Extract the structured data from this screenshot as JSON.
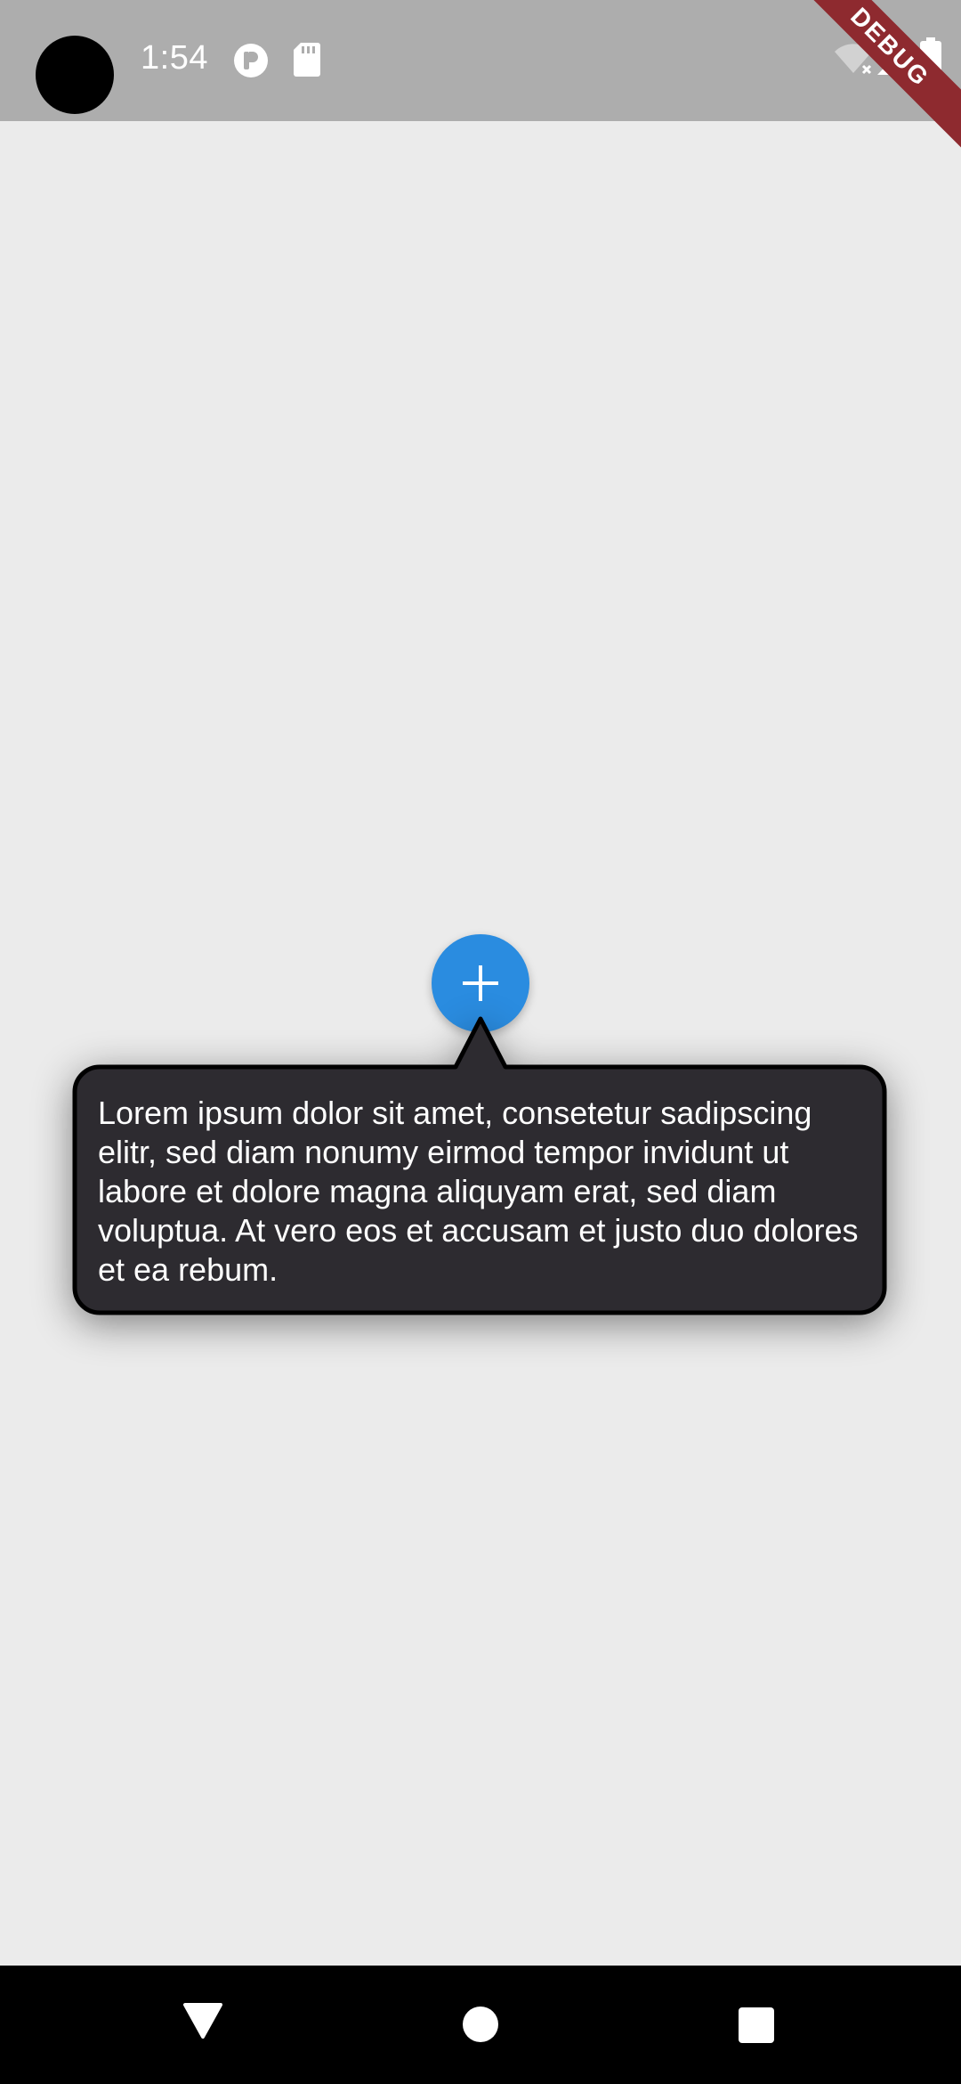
{
  "status_bar": {
    "time": "1:54",
    "icons": [
      "camera-cutout",
      "notification-app-icon",
      "sd-card-icon",
      "wifi-off-icon",
      "signal-icon",
      "battery-icon"
    ],
    "debug_banner": "DEBUG"
  },
  "fab": {
    "icon": "plus-icon",
    "color": "#2a8ce0"
  },
  "tooltip": {
    "text": "Lorem ipsum dolor sit amet, consetetur sadipscing elitr, sed diam nonumy eirmod tempor invidunt ut labore et dolore magna aliquyam erat, sed diam voluptua. At vero eos et accusam et justo duo dolores et ea rebum.",
    "background": "#2d2b30"
  },
  "nav_bar": {
    "buttons": [
      "back-icon",
      "home-icon",
      "recents-icon"
    ]
  }
}
